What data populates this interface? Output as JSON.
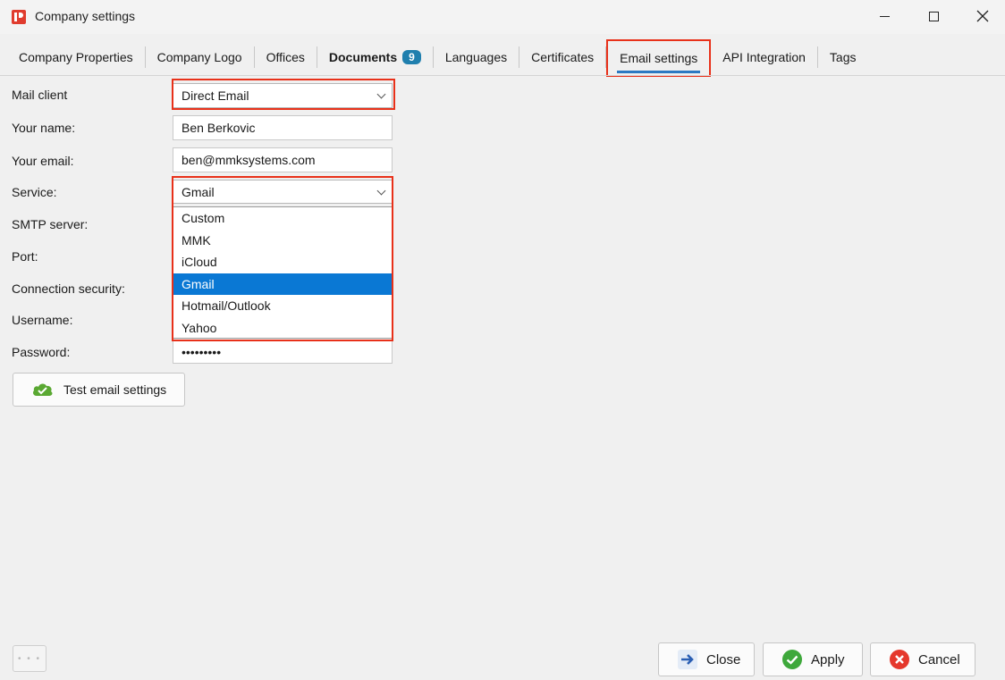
{
  "window": {
    "title": "Company settings",
    "app_icon": "app-logo-icon"
  },
  "tabs": [
    {
      "label": "Company Properties"
    },
    {
      "label": "Company Logo"
    },
    {
      "label": "Offices"
    },
    {
      "label": "Documents",
      "badge": "9"
    },
    {
      "label": "Languages"
    },
    {
      "label": "Certificates"
    },
    {
      "label": "Email settings",
      "active": true
    },
    {
      "label": "API Integration"
    },
    {
      "label": "Tags"
    }
  ],
  "form": {
    "mail_client_label": "Mail client",
    "mail_client_value": "Direct Email",
    "your_name_label": "Your name:",
    "your_name_value": "Ben Berkovic",
    "your_email_label": "Your email:",
    "your_email_value": "ben@mmksystems.com",
    "service_label": "Service:",
    "service_value": "Gmail",
    "smtp_label": "SMTP server:",
    "port_label": "Port:",
    "security_label": "Connection security:",
    "username_label": "Username:",
    "password_label": "Password:",
    "password_value": "•••••••••"
  },
  "service_options": [
    "Custom",
    "MMK",
    "iCloud",
    "Gmail",
    "Hotmail/Outlook",
    "Yahoo"
  ],
  "service_selected": "Gmail",
  "test_button": {
    "label": "Test email settings",
    "icon": "cloud-check-icon"
  },
  "footer": {
    "more_label": "• • •",
    "close_label": "Close",
    "apply_label": "Apply",
    "cancel_label": "Cancel"
  },
  "colors": {
    "highlight": "#e8311a",
    "selection": "#0a78d4",
    "badge": "#1f7fae",
    "active_tab_underline": "#2b79c2"
  }
}
